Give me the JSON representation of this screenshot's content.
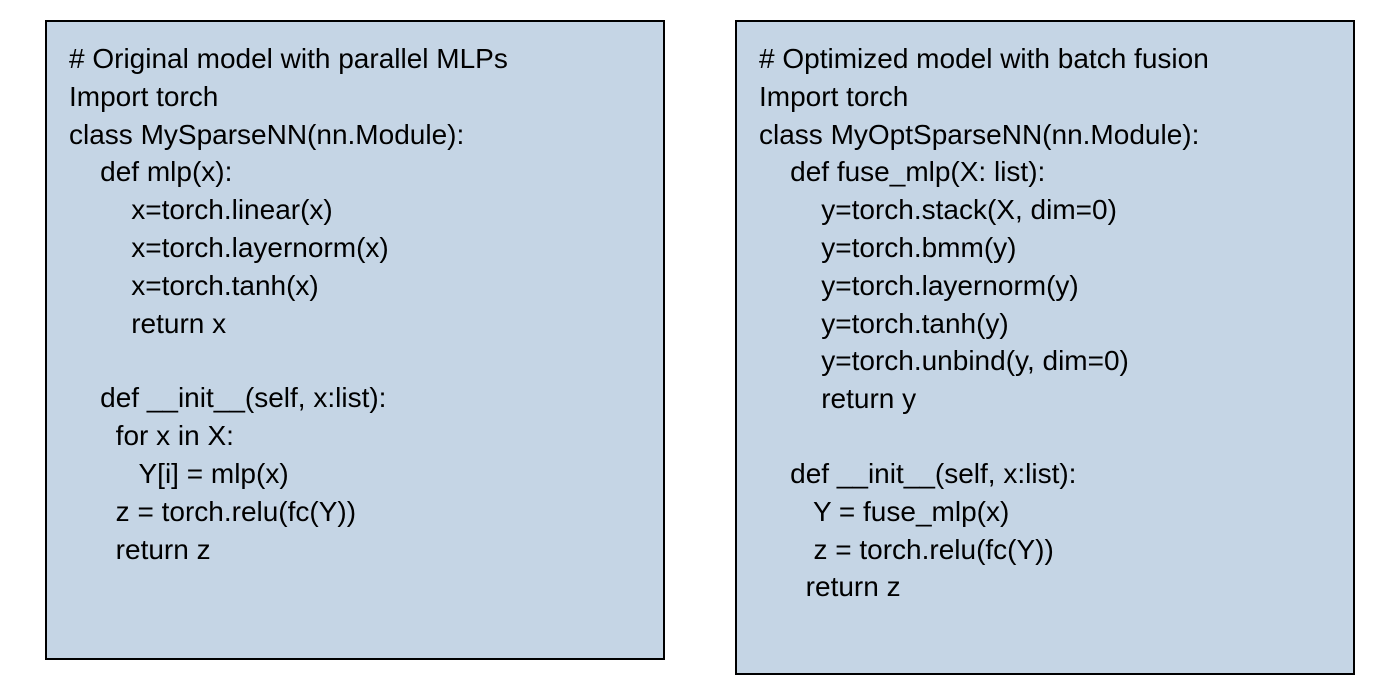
{
  "left": {
    "lines": [
      "# Original model with parallel MLPs",
      "Import torch",
      "class MySparseNN(nn.Module):",
      "    def mlp(x):",
      "        x=torch.linear(x)",
      "        x=torch.layernorm(x)",
      "        x=torch.tanh(x)",
      "        return x",
      "",
      "    def __init__(self, x:list):",
      "      for x in X:",
      "         Y[i] = mlp(x)",
      "      z = torch.relu(fc(Y))",
      "      return z"
    ]
  },
  "right": {
    "lines": [
      "# Optimized model with batch fusion",
      "Import torch",
      "class MyOptSparseNN(nn.Module):",
      "    def fuse_mlp(X: list):",
      "        y=torch.stack(X, dim=0)",
      "        y=torch.bmm(y)",
      "        y=torch.layernorm(y)",
      "        y=torch.tanh(y)",
      "        y=torch.unbind(y, dim=0)",
      "        return y",
      "",
      "    def __init__(self, x:list):",
      "       Y = fuse_mlp(x)",
      "       z = torch.relu(fc(Y))",
      "      return z"
    ]
  }
}
